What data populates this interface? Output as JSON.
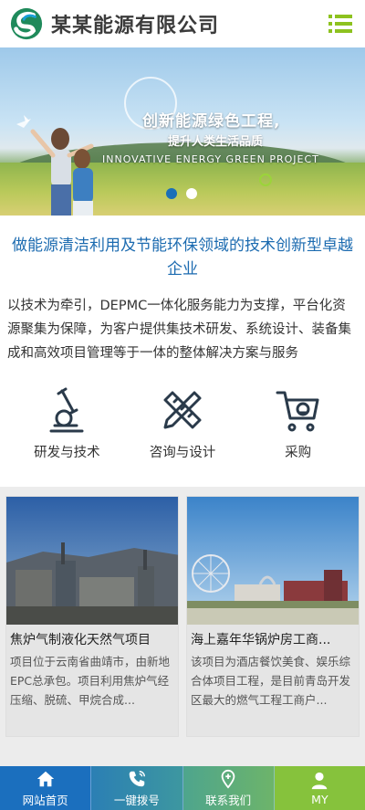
{
  "header": {
    "company_name": "某某能源有限公司",
    "logo_icon": "logo-mark",
    "menu_icon": "menu-icon",
    "brand_color": "#8dc21f"
  },
  "banner": {
    "slogan_line1": "创新能源绿色工程,",
    "slogan_line2": "提升人类生活品质",
    "slogan_line3": "INNOVATIVE ENERGY GREEN PROJECT",
    "slides": 2,
    "active_slide": 1
  },
  "about": {
    "title": "做能源清洁利用及节能环保领域的技术创新型卓越企业",
    "description": "以技术为牵引，DEPMC一体化服务能力为支撑，平台化资源聚集为保障，为客户提供集技术研发、系统设计、装备集成和高效项目管理等于一体的整体解决方案与服务"
  },
  "features": [
    {
      "label": "研发与技术",
      "icon": "microscope-icon"
    },
    {
      "label": "咨询与设计",
      "icon": "pencil-ruler-icon"
    },
    {
      "label": "采购",
      "icon": "shopping-cart-icon"
    }
  ],
  "projects": [
    {
      "title": "焦炉气制液化天然气项目",
      "summary": "项目位于云南省曲靖市，由新地EPC总承包。项目利用焦炉气经压缩、脱硫、甲烷合成..."
    },
    {
      "title": "海上嘉年华锅炉房工商...",
      "summary": "该项目为酒店餐饮美食、娱乐综合体项目工程，是目前青岛开发区最大的燃气工程工商户..."
    }
  ],
  "bottom_nav": [
    {
      "label": "网站首页",
      "icon": "home-icon"
    },
    {
      "label": "一键拨号",
      "icon": "phone-icon"
    },
    {
      "label": "联系我们",
      "icon": "location-pin-icon"
    },
    {
      "label": "MY",
      "icon": "user-icon"
    }
  ],
  "colors": {
    "title_blue": "#1c6bb0",
    "nav_home": "#1b6fbe",
    "nav_my": "#86c23c"
  }
}
